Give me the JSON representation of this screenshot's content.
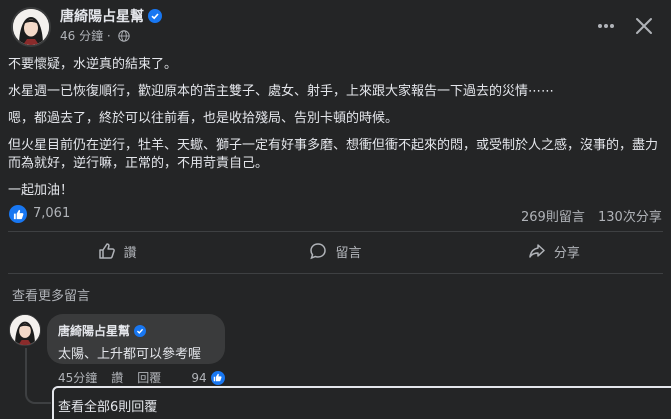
{
  "post": {
    "author": "唐綺陽占星幫",
    "time": "46 分鐘",
    "paragraphs": [
      "不要懷疑，水逆真的結束了。",
      "水星週一已恢復順行，歡迎原本的苦主雙子、處女、射手，上來跟大家報告一下過去的災情⋯⋯",
      "嗯，都過去了，終於可以往前看，也是收拾殘局、告別卡頓的時候。",
      "但火星目前仍在逆行，牡羊、天蠍、獅子一定有好事多磨、想衝但衝不起來的悶，或受制於人之感，沒事的，盡力而為就好，逆行嘛，正常的，不用苛責自己。",
      "一起加油！"
    ],
    "reaction_count": "7,061",
    "comment_count": "269則留言",
    "share_count": "130次分享"
  },
  "actions": {
    "like": "讚",
    "comment": "留言",
    "share": "分享"
  },
  "comments": {
    "view_more": "查看更多留言",
    "items": [
      {
        "author": "唐綺陽占星幫",
        "text": "太陽、上升都可以參考喔",
        "time": "45分鐘",
        "like_label": "讚",
        "reply_label": "回覆",
        "likes": "94"
      }
    ],
    "view_replies": "查看全部6則回覆"
  },
  "colors": {
    "background": "#242526",
    "bubble": "#3a3b3c",
    "accent": "#1877f2"
  }
}
